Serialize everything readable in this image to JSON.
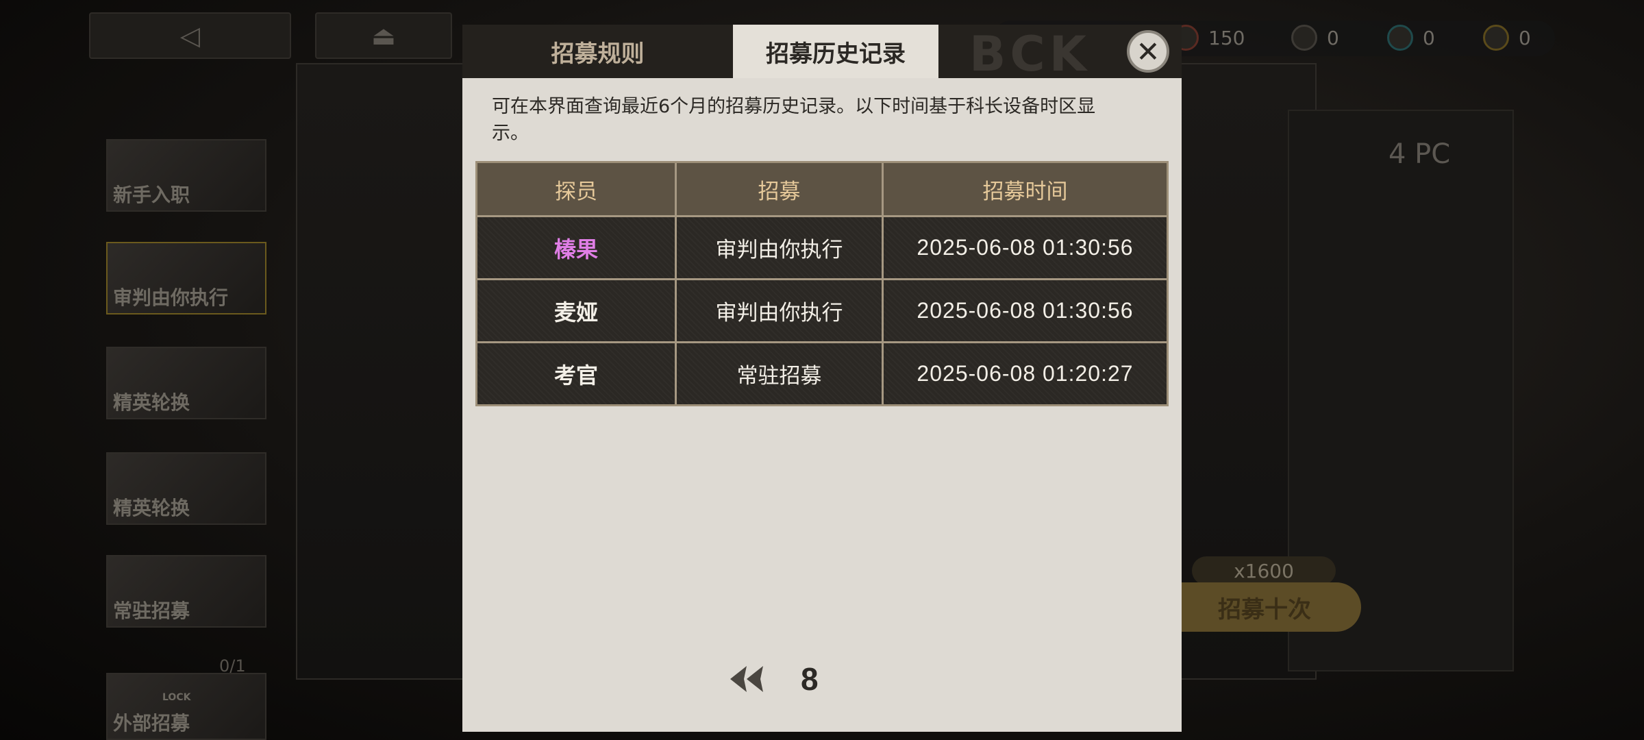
{
  "background": {
    "back_icon": "back-triangle-icon",
    "home_icon": "home-icon",
    "resources": [
      {
        "icon": "currency-red-icon",
        "value": "150"
      },
      {
        "icon": "gear-coin-icon",
        "value": "0"
      },
      {
        "icon": "cyan-coin-icon",
        "value": "0"
      },
      {
        "icon": "gold-coin-icon",
        "value": "0"
      }
    ],
    "sidebar_banners": [
      {
        "label": "新手入职"
      },
      {
        "label": "审判由你执行"
      },
      {
        "label": "精英轮换"
      },
      {
        "label": "精英轮换"
      },
      {
        "label": "常驻招募"
      },
      {
        "label": "外部招募"
      }
    ],
    "locked_counter": "0/1",
    "lock_text": "LOCK",
    "ten_pull_cost": "x1600",
    "ten_pull_label": "招募十次",
    "card_text": "4 PC"
  },
  "modal": {
    "tabs": [
      {
        "label": "招募规则",
        "active": false
      },
      {
        "label": "招募历史记录",
        "active": true
      }
    ],
    "watermark": "BCK",
    "close_icon": "close-x-icon",
    "notice": "可在本界面查询最近6个月的招募历史记录。以下时间基于科长设备时区显示。",
    "table": {
      "headers": [
        "探员",
        "招募",
        "招募时间"
      ],
      "rows": [
        {
          "agent": "榛果",
          "banner": "审判由你执行",
          "time": "2025-06-08 01:30:56",
          "highlight_color": "#e07ee6"
        },
        {
          "agent": "麦娅",
          "banner": "审判由你执行",
          "time": "2025-06-08 01:30:56"
        },
        {
          "agent": "考官",
          "banner": "常驻招募",
          "time": "2025-06-08 01:20:27"
        }
      ]
    },
    "pagination": {
      "prev_icon": "double-chevron-left-icon",
      "page": "8"
    }
  },
  "colors": {
    "header_text": "#e6c99a",
    "highlight_agent": "#e07ee6",
    "modal_bg": "#dedad3"
  }
}
